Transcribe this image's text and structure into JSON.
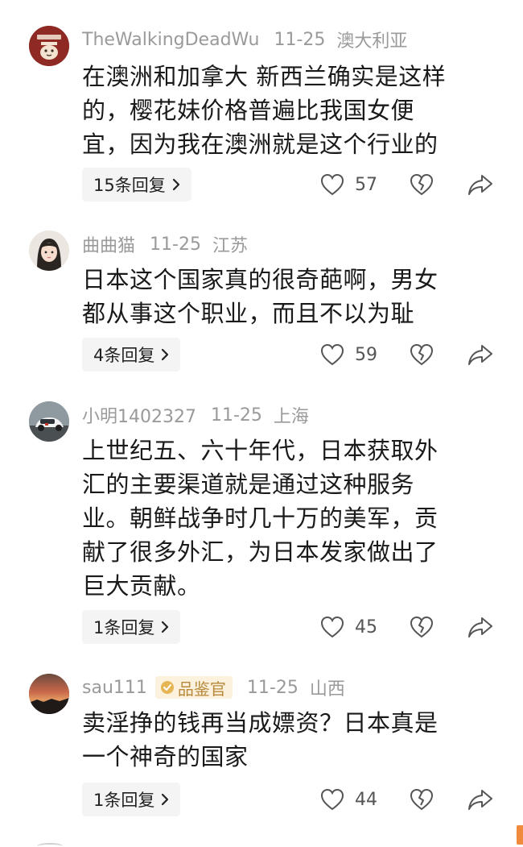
{
  "comments": [
    {
      "username": "TheWalkingDeadWu",
      "date": "11-25",
      "location": "澳大利亚",
      "avatar_icon": "cartoon-cat-avatar",
      "badge": null,
      "lines": [
        "在澳洲和加拿大 新西兰确实是这样",
        "的，樱花妹价格普遍比我国女便",
        "宜，因为我在澳洲就是这个行业的"
      ],
      "reply_label": "15条回复",
      "like_count": "57"
    },
    {
      "username": "曲曲猫",
      "date": "11-25",
      "location": "江苏",
      "avatar_icon": "girl-portrait-avatar",
      "badge": null,
      "lines": [
        "日本这个国家真的很奇葩啊，男女",
        "都从事这个职业，而且不以为耻"
      ],
      "reply_label": "4条回复",
      "like_count": "59"
    },
    {
      "username": "小明1402327",
      "date": "11-25",
      "location": "上海",
      "avatar_icon": "car-photo-avatar",
      "badge": null,
      "lines": [
        "上世纪五、六十年代，日本获取外",
        "汇的主要渠道就是通过这种服务",
        "业。朝鲜战争时几十万的美军，贡",
        "献了很多外汇，为日本发家做出了",
        "巨大贡献。"
      ],
      "reply_label": "1条回复",
      "like_count": "45"
    },
    {
      "username": "sau111",
      "date": "11-25",
      "location": "山西",
      "avatar_icon": "sunset-photo-avatar",
      "badge": "品鉴官",
      "lines": [
        "卖淫挣的钱再当成嫖资？日本真是",
        "一个神奇的国家"
      ],
      "reply_label": "1条回复",
      "like_count": "44"
    }
  ],
  "colors": {
    "meta_gray": "#9a9a9a",
    "text": "#1a1a1a",
    "reply_bg": "#f4f4f4",
    "badge_bg": "#fbf1dc",
    "badge_text": "#b7893b",
    "scroll_accent": "#f08a3c"
  }
}
